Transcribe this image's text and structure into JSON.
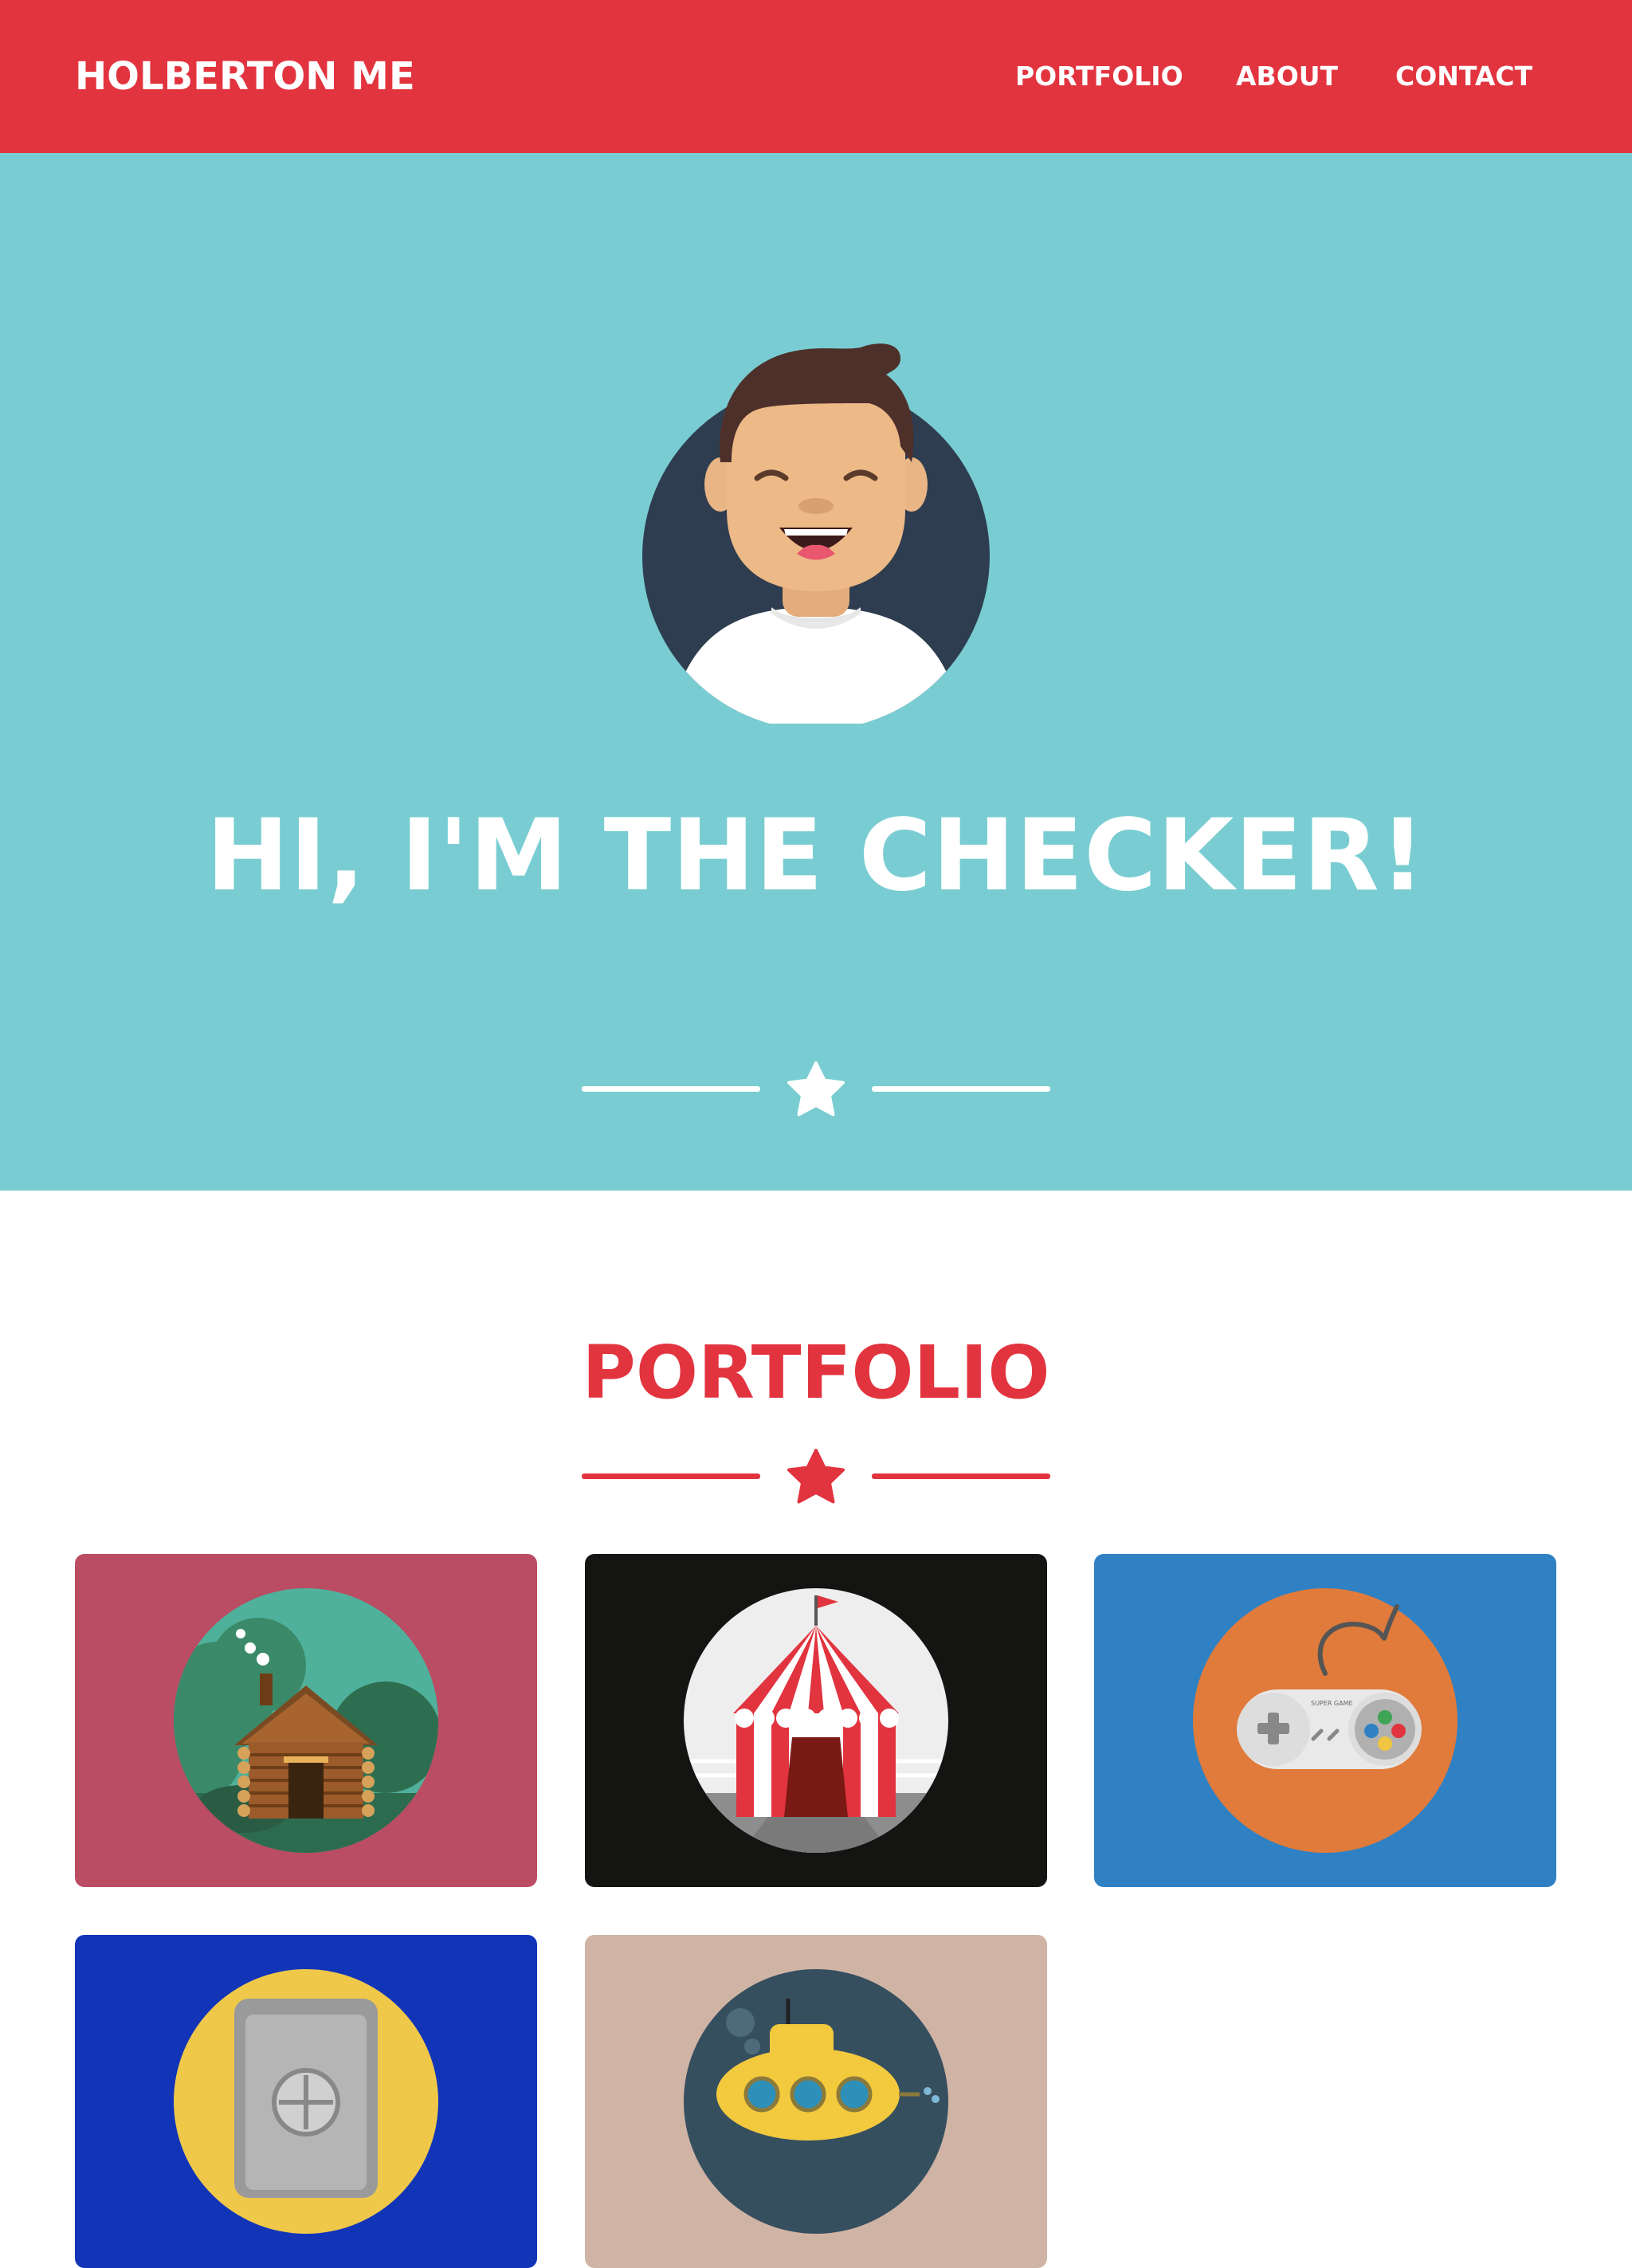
{
  "navbar": {
    "brand": "HOLBERTON ME",
    "items": [
      "PORTFOLIO",
      "ABOUT",
      "CONTACT"
    ],
    "background": "#e2343f"
  },
  "hero": {
    "title": "HI, I'M THE CHECKER!",
    "background": "#79cdd2",
    "avatar_icon": "smiling-man-avatar",
    "divider_icon": "star-icon"
  },
  "portfolio": {
    "title": "PORTFOLIO",
    "accent": "#e2343f",
    "items": [
      {
        "icon": "log-cabin-icon",
        "background": "#ba4c63"
      },
      {
        "icon": "circus-tent-icon",
        "background": "#141413"
      },
      {
        "icon": "game-controller-icon",
        "background": "#2f81c4",
        "label": "SUPER GAME"
      },
      {
        "icon": "safe-icon",
        "background": "#1235b8"
      },
      {
        "icon": "submarine-icon",
        "background": "#cfb3a5"
      }
    ]
  }
}
